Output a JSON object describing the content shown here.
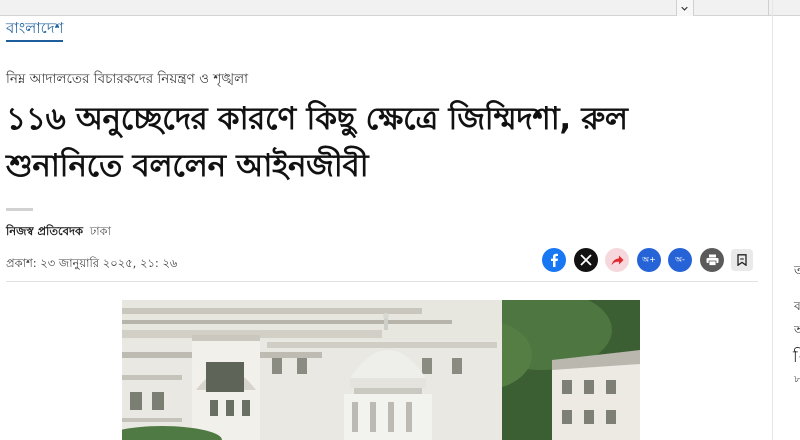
{
  "section": {
    "label": "বাংলাদেশ"
  },
  "article": {
    "kicker": "নিম্ন আদালতের বিচারকদের নিয়ন্ত্রণ ও শৃঙ্খলা",
    "headline": "১১৬ অনুচ্ছেদের কারণে কিছু ক্ষেত্রে জিম্মিদশা, রুল শুনানিতে বললেন আইনজীবী",
    "byline": {
      "author": "নিজস্ব প্রতিবেদক",
      "location": "ঢাকা"
    },
    "published": "প্রকাশ: ২৩ জানুয়ারি ২০২৫, ২১: ২৬"
  },
  "share": {
    "icons": [
      "facebook-icon",
      "x-icon",
      "forward-icon",
      "font-increase-icon",
      "font-decrease-icon",
      "print-icon",
      "bookmark-icon"
    ],
    "font_increase_label": "অ+",
    "font_decrease_label": "অ-"
  },
  "right_rail": {
    "fragments": [
      "ত",
      "ব",
      "অ",
      "ি",
      "৮"
    ]
  },
  "colors": {
    "section_blue": "#1d5f9d",
    "facebook": "#1877f2",
    "x": "#121212",
    "forward_bg": "#f6d8dc",
    "forward_arrow": "#e0282e",
    "font_btn": "#2563d6",
    "print": "#5a5a5a"
  }
}
